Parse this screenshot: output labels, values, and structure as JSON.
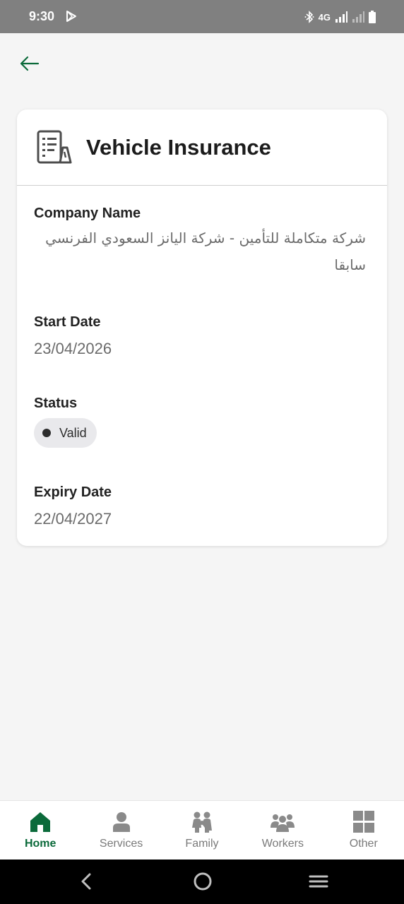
{
  "status_bar": {
    "time": "9:30",
    "network": "4G",
    "icons": [
      "play-store-icon",
      "bluetooth-icon",
      "signal-icon",
      "signal-weak-icon",
      "battery-icon"
    ]
  },
  "header": {
    "back_icon": "arrow-left-icon"
  },
  "card": {
    "title": "Vehicle Insurance",
    "icon": "document-icon",
    "fields": {
      "company_label": "Company Name",
      "company_value": "شركة متكاملة للتأمين - شركة اليانز السعودي الفرنسي سابقا",
      "start_label": "Start Date",
      "start_value": "23/04/2026",
      "status_label": "Status",
      "status_value": "Valid",
      "expiry_label": "Expiry Date",
      "expiry_value": "22/04/2027"
    }
  },
  "bottom_nav": {
    "items": [
      {
        "label": "Home",
        "icon": "home-icon",
        "active": true
      },
      {
        "label": "Services",
        "icon": "person-icon",
        "active": false
      },
      {
        "label": "Family",
        "icon": "family-icon",
        "active": false
      },
      {
        "label": "Workers",
        "icon": "workers-icon",
        "active": false
      },
      {
        "label": "Other",
        "icon": "grid-icon",
        "active": false
      }
    ]
  },
  "colors": {
    "brand_green": "#0b6a3a",
    "inactive_gray": "#7a7a7a",
    "background": "#f5f5f5"
  }
}
